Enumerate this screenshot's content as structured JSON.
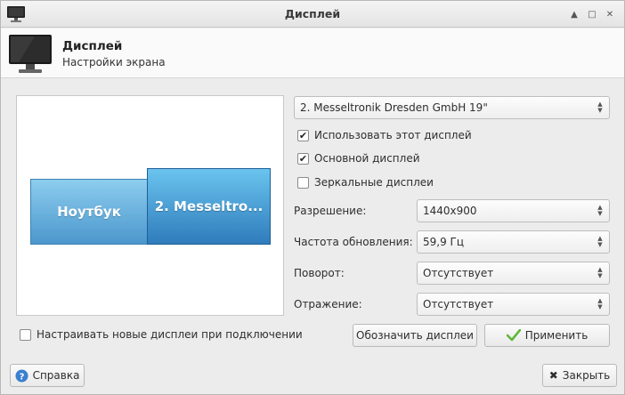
{
  "window": {
    "title": "Дисплей"
  },
  "header": {
    "title": "Дисплей",
    "subtitle": "Настройки экрана"
  },
  "preview": {
    "laptop_label": "Ноутбук",
    "external_label": "2. Messeltro..."
  },
  "display_select": {
    "value": "2. Messeltronik Dresden GmbH 19\""
  },
  "options": {
    "use_display": {
      "label": "Использовать этот дисплей",
      "checked": true
    },
    "primary_display": {
      "label": "Основной дисплей",
      "checked": true
    },
    "mirror_displays": {
      "label": "Зеркальные дисплеи",
      "checked": false
    }
  },
  "fields": {
    "resolution": {
      "label": "Разрешение:",
      "value": "1440x900"
    },
    "refresh_rate": {
      "label": "Частота обновления:",
      "value": "59,9 Гц"
    },
    "rotation": {
      "label": "Поворот:",
      "value": "Отсутствует"
    },
    "reflection": {
      "label": "Отражение:",
      "value": "Отсутствует"
    }
  },
  "configure_new": {
    "label": "Настраивать новые дисплеи при подключении",
    "checked": false
  },
  "buttons": {
    "identify": "Обозначить дисплеи",
    "apply": "Применить",
    "help": "Справка",
    "close": "Закрыть"
  },
  "colors": {
    "tile_accent": "#2f7cbc",
    "apply_check": "#5fb83a",
    "help_icon": "#3a7fd0"
  }
}
